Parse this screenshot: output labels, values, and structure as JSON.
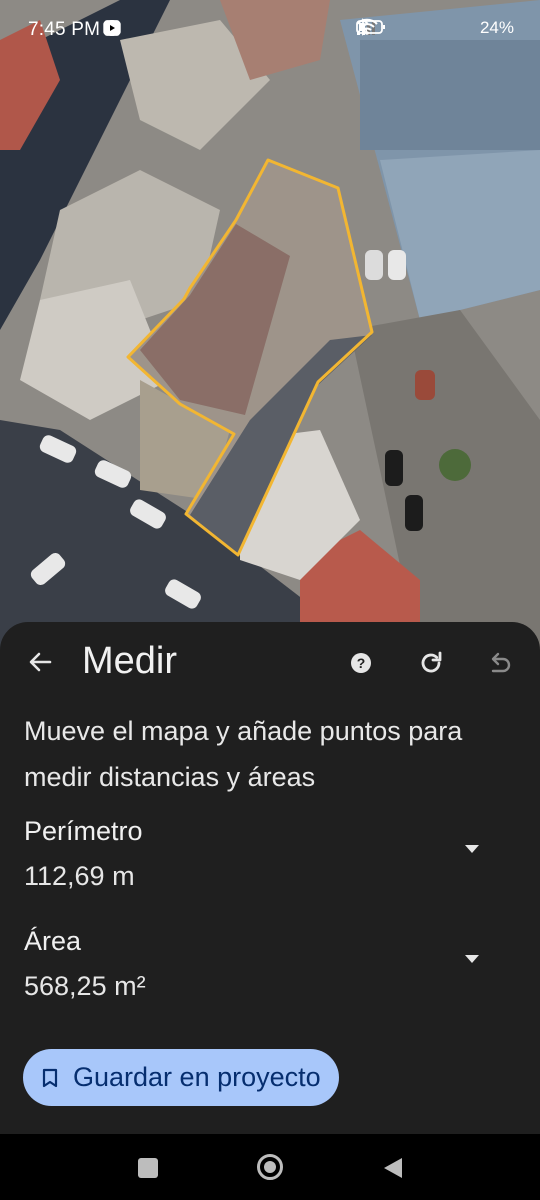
{
  "status_bar": {
    "time": "7:45 PM",
    "battery_percent": "24",
    "left_icons": [
      "alarm-icon",
      "nfc-icon",
      "messenger-icon",
      "temu-icon",
      "youtube-icon"
    ],
    "right_icons": [
      "bluetooth-icon",
      "signal-icon",
      "wifi-icon",
      "battery-icon"
    ]
  },
  "map": {
    "view": "satellite",
    "measured_outline_color": "#f2b632"
  },
  "measure_panel": {
    "title": "Medir",
    "instructions": "Mueve el mapa y añade puntos para medir distancias y áreas",
    "perimeter": {
      "label": "Perímetro",
      "value": "112,69 m"
    },
    "area": {
      "label": "Área",
      "value": "568,25 m²"
    },
    "save_button": "Guardar en proyecto",
    "icons": [
      "back-arrow-icon",
      "help-icon",
      "reset-icon",
      "undo-icon",
      "bookmark-icon",
      "chevron-down-icon"
    ]
  },
  "colors": {
    "panel_background": "#1f1f1f",
    "save_button_background": "#a8c7fa",
    "save_button_text": "#062e6f"
  }
}
